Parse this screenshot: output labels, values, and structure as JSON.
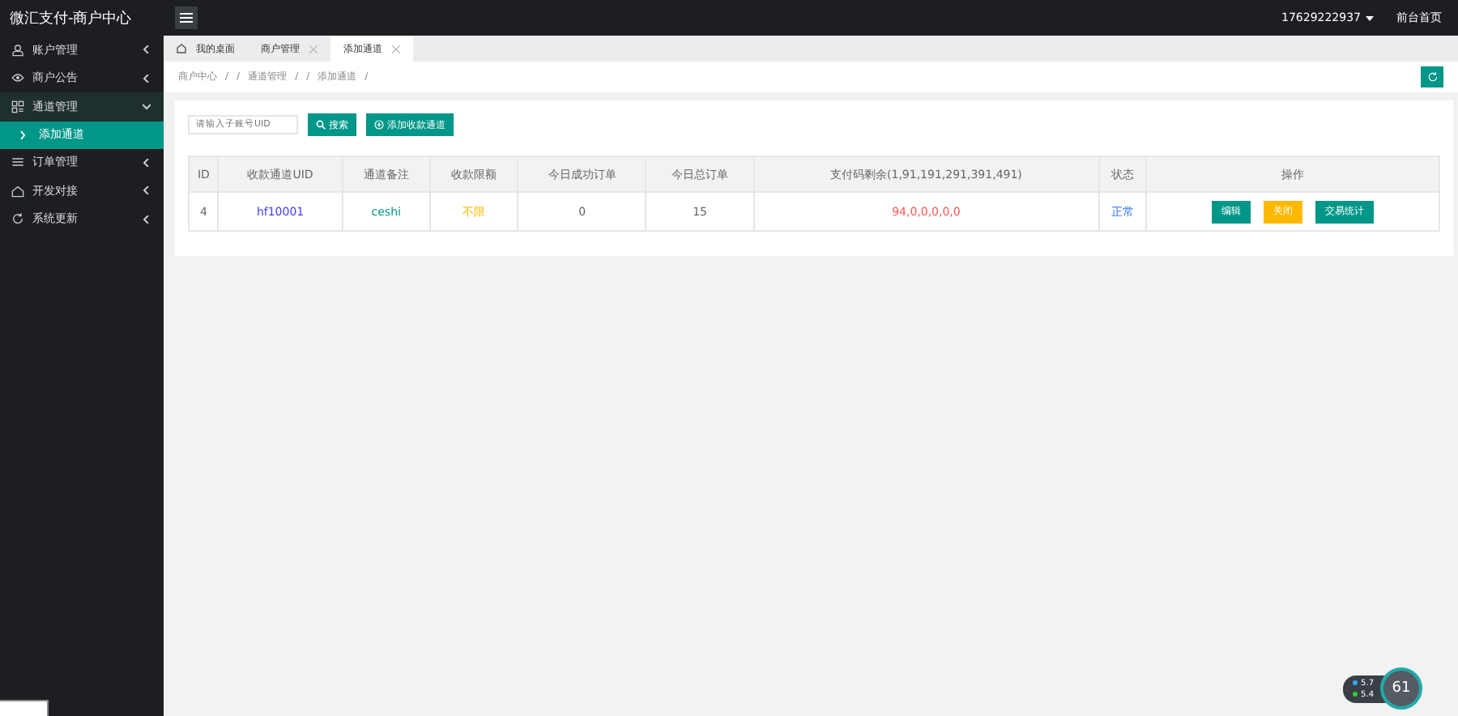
{
  "app_title": "微汇支付-商户中心",
  "user": {
    "phone": "17629222937",
    "home_link": "前台首页"
  },
  "sidebar": {
    "items": [
      {
        "label": "账户管理",
        "expanded": false
      },
      {
        "label": "商户公告",
        "expanded": false
      },
      {
        "label": "通道管理",
        "expanded": true,
        "children": [
          {
            "label": "添加通道",
            "selected": true
          }
        ]
      },
      {
        "label": "订单管理",
        "expanded": false
      },
      {
        "label": "开发对接",
        "expanded": false
      },
      {
        "label": "系统更新",
        "expanded": false
      }
    ]
  },
  "tabs": [
    {
      "label": "我的桌面",
      "closable": false,
      "selected": false
    },
    {
      "label": "商户管理",
      "closable": true,
      "selected": false
    },
    {
      "label": "添加通道",
      "closable": true,
      "selected": true
    }
  ],
  "breadcrumb": [
    "商户中心",
    "/",
    "/",
    "通道管理",
    "/",
    "/",
    "添加通道",
    "/"
  ],
  "search": {
    "placeholder": "请输入子账号UID",
    "button": "搜索"
  },
  "add_button": "添加收款通道",
  "table": {
    "columns": [
      "ID",
      "收款通道UID",
      "通道备注",
      "收款限额",
      "今日成功订单",
      "今日总订单",
      "支付码剩余(1,91,191,291,391,491)",
      "状态",
      "操作"
    ],
    "rows": [
      {
        "cells": [
          "4",
          "hf10001",
          "ceshi",
          "不限",
          "0",
          "15",
          "94,0,0,0,0,0",
          "正常"
        ],
        "actions": [
          {
            "label": "编辑",
            "kind": "primary"
          },
          {
            "label": "关闭",
            "kind": "warn"
          },
          {
            "label": "交易统计",
            "kind": "primary"
          }
        ]
      }
    ]
  },
  "speed_widget": {
    "upload": "5.7",
    "download": "5.4",
    "percent": "61"
  }
}
